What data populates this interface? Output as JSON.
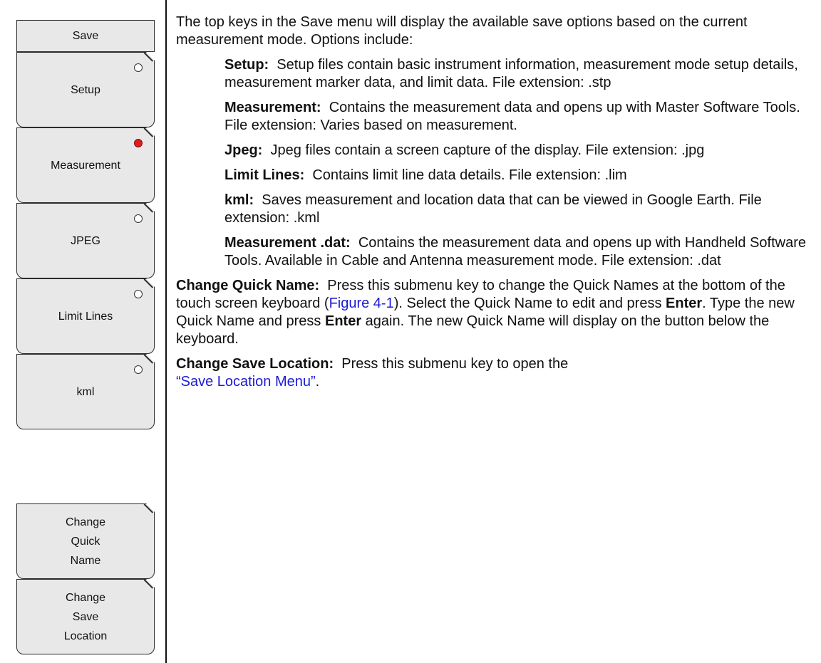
{
  "menu": {
    "title": "Save",
    "keys": [
      {
        "label": "Setup",
        "selected": false
      },
      {
        "label": "Measurement",
        "selected": true
      },
      {
        "label": "JPEG",
        "selected": false
      },
      {
        "label": "Limit Lines",
        "selected": false
      },
      {
        "label": "kml",
        "selected": false
      }
    ],
    "submenu": [
      {
        "lines": [
          "Change",
          "Quick",
          "Name"
        ]
      },
      {
        "lines": [
          "Change",
          "Save",
          "Location"
        ]
      }
    ]
  },
  "content": {
    "intro": "The top keys in the Save menu will display the available save options based on the current measurement mode. Options include:",
    "options": [
      {
        "term": "Setup:",
        "desc": "Setup files contain basic instrument information, measurement mode setup details, measurement marker data, and limit data. File extension: .stp"
      },
      {
        "term": "Measurement:",
        "desc": "Contains the measurement data and opens up with Master Software Tools. File extension: Varies based on measurement."
      },
      {
        "term": "Jpeg:",
        "desc": "Jpeg files contain a screen capture of the display. File extension: .jpg"
      },
      {
        "term": "Limit Lines:",
        "desc": "Contains limit line data details. File extension: .lim"
      },
      {
        "term": "kml:",
        "desc": "Saves measurement and location data that can be viewed in Google Earth. File extension: .kml"
      },
      {
        "term": "Measurement .dat:",
        "desc": "Contains the measurement data and opens up with Handheld Software Tools. Available in Cable and Antenna measurement mode. File extension: .dat"
      }
    ],
    "quick_name": {
      "term": "Change Quick Name:",
      "t1": "Press this submenu key to change the Quick Names at the bottom of the touch screen keyboard (",
      "link": "Figure 4-1",
      "t2": "). Select the Quick Name to edit and press ",
      "enter1": "Enter",
      "t3": ". Type the new Quick Name and press ",
      "enter2": "Enter",
      "t4": " again. The new Quick Name will display on the button below the keyboard."
    },
    "save_location": {
      "term": "Change Save Location:",
      "t1": "Press this submenu key to open the",
      "link": "“Save Location Menu”",
      "t2": "."
    }
  },
  "colors": {
    "key_bg": "#e8e8e8",
    "radio_on": "#e51b1b",
    "link": "#1b1bd6"
  }
}
